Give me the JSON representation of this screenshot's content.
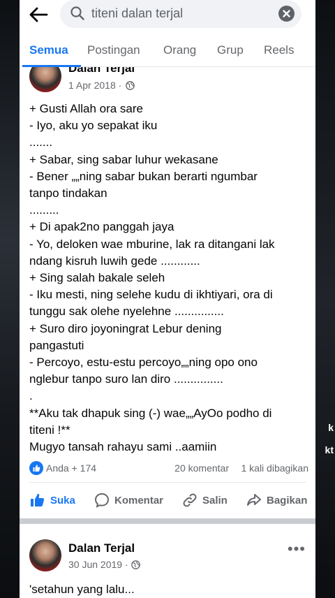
{
  "search": {
    "query": "titeni dalan terjal"
  },
  "tabs": [
    {
      "label": "Semua"
    },
    {
      "label": "Postingan"
    },
    {
      "label": "Orang"
    },
    {
      "label": "Grup"
    },
    {
      "label": "Reels"
    }
  ],
  "post1": {
    "author": "Dalan Terjal",
    "date": "1 Apr 2018 ·",
    "lines": [
      "+ Gusti Allah ora sare",
      "- Iyo, aku yo sepakat iku",
      ".......",
      "+ Sabar, sing sabar luhur wekasane",
      "- Bener „„ning sabar bukan berarti ngumbar",
      "tanpo tindakan",
      ".........",
      "+ Di apak2no panggah jaya",
      "- Yo, deloken wae mburine, lak ra ditangani lak",
      "ndang kisruh luwih gede ............",
      "+ Sing salah bakale seleh",
      "- Iku mesti, ning selehe kudu di ikhtiyari, ora di",
      "tunggu sak olehe nyelehne ...............",
      "+ Suro diro joyoningrat Lebur dening",
      "pangastuti",
      "- Percoyo, estu-estu percoyo„„ning opo ono",
      "nglebur tanpo suro lan diro ...............",
      ".",
      "**Aku tak dhapuk sing (-) wae„„AyOo podho di",
      "titeni !**",
      "Mugyo tansah rahayu sami ..aamiin"
    ],
    "reactions": "Anda + 174",
    "comments": "20 komentar",
    "shares": "1 kali dibagikan",
    "actions": {
      "like": "Suka",
      "comment": "Komentar",
      "share": "Salin",
      "forward": "Bagikan"
    }
  },
  "post2": {
    "author": "Dalan Terjal",
    "date": "30 Jun 2019 ·",
    "first_line": "'setahun yang lalu..."
  },
  "side": {
    "right_text_1": "k",
    "right_text_2": "kt"
  },
  "colors": {
    "accent": "#1877f2",
    "muted": "#65676b",
    "text": "#050505"
  }
}
